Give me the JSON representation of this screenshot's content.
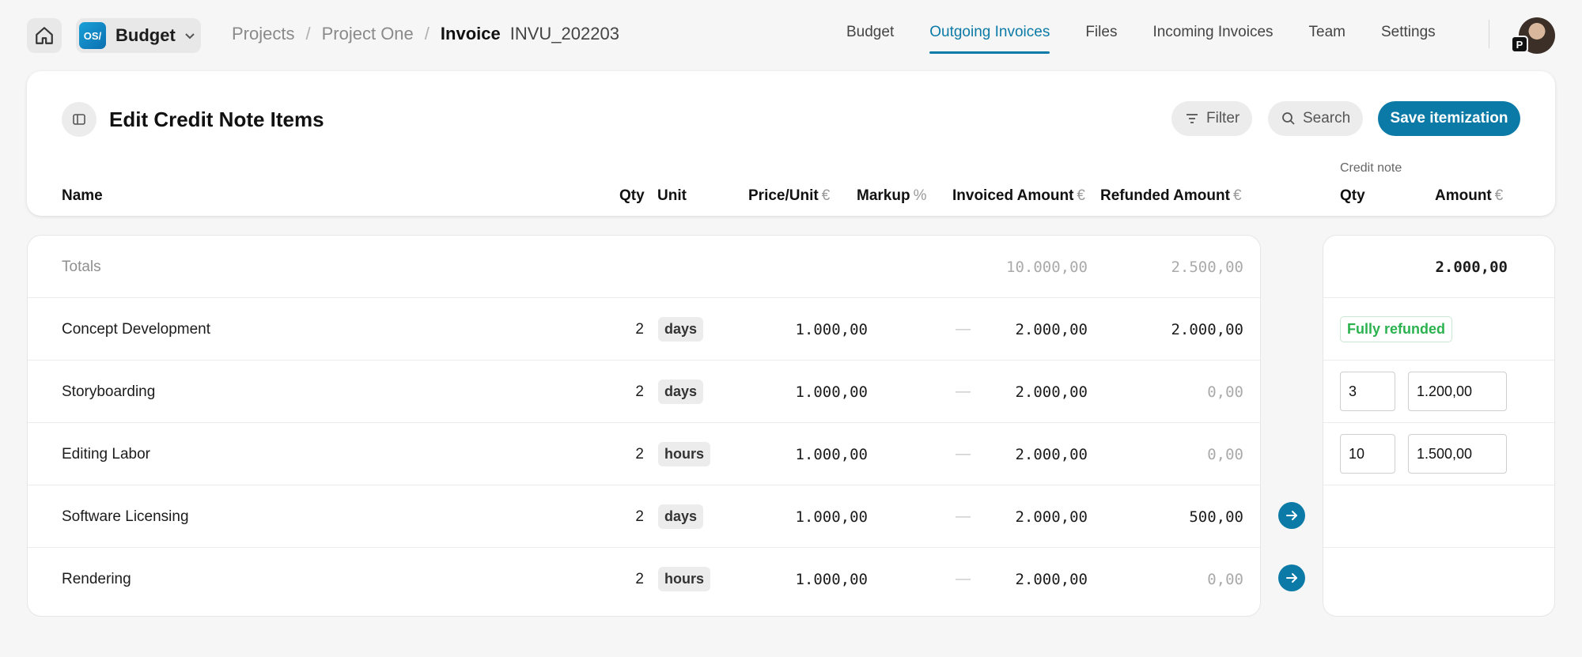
{
  "topbar": {
    "app_logo": "OS/",
    "app_name": "Budget",
    "breadcrumb": [
      "Projects",
      "Project One"
    ],
    "current": "Invoice",
    "invoice_number": "INVU_202203",
    "nav": [
      "Budget",
      "Outgoing Invoices",
      "Files",
      "Incoming Invoices",
      "Team",
      "Settings"
    ],
    "active_nav": "Outgoing Invoices",
    "avatar_badge": "P"
  },
  "header": {
    "title": "Edit Credit Note Items",
    "filter_label": "Filter",
    "search_label": "Search",
    "save_label": "Save itemization",
    "credit_note_label": "Credit note",
    "columns": {
      "name": "Name",
      "qty": "Qty",
      "unit": "Unit",
      "price": "Price/Unit",
      "price_unit": "€",
      "markup": "Markup",
      "markup_unit": "%",
      "invoiced": "Invoiced Amount",
      "invoiced_unit": "€",
      "refunded": "Refunded Amount",
      "refunded_unit": "€",
      "cn_qty": "Qty",
      "cn_amount": "Amount",
      "cn_amount_unit": "€"
    }
  },
  "totals": {
    "label": "Totals",
    "invoiced": "10.000,00",
    "refunded": "2.500,00",
    "credit_amount": "2.000,00"
  },
  "rows": [
    {
      "name": "Concept Development",
      "qty": "2",
      "unit": "days",
      "price": "1.000,00",
      "markup": "—",
      "invoiced": "2.000,00",
      "refunded": "2.000,00",
      "status": "Fully refunded"
    },
    {
      "name": "Storyboarding",
      "qty": "2",
      "unit": "days",
      "price": "1.000,00",
      "markup": "—",
      "invoiced": "2.000,00",
      "refunded": "0,00",
      "cn_qty": "3",
      "cn_amount": "1.200,00"
    },
    {
      "name": "Editing Labor",
      "qty": "2",
      "unit": "hours",
      "price": "1.000,00",
      "markup": "—",
      "invoiced": "2.000,00",
      "refunded": "0,00",
      "cn_qty": "10",
      "cn_amount": "1.500,00"
    },
    {
      "name": "Software Licensing",
      "qty": "2",
      "unit": "days",
      "price": "1.000,00",
      "markup": "—",
      "invoiced": "2.000,00",
      "refunded": "500,00"
    },
    {
      "name": "Rendering",
      "qty": "2",
      "unit": "hours",
      "price": "1.000,00",
      "markup": "—",
      "invoiced": "2.000,00",
      "refunded": "0,00"
    }
  ],
  "colors": {
    "accent": "#0b7aa6",
    "success": "#2bb24f",
    "background": "#f6f6f6"
  }
}
